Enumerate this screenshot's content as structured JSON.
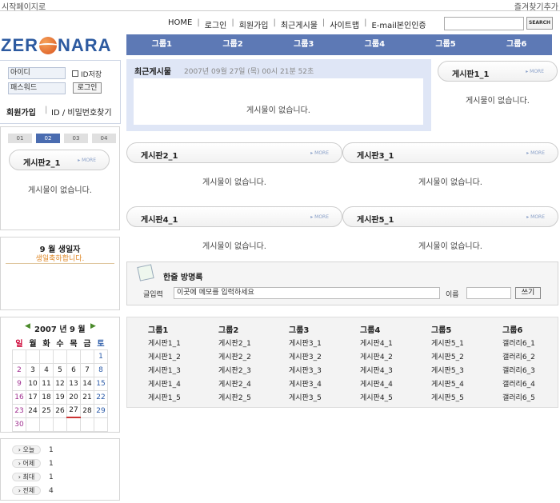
{
  "topbar": {
    "left": "시작페이지로",
    "right": "즐겨찾기추가"
  },
  "topnav": [
    "HOME",
    "로그인",
    "회원가입",
    "최근게시물",
    "사이트맵",
    "E-mail본인인증"
  ],
  "search": {
    "button": "SEARCH"
  },
  "logo": {
    "left": "ZER",
    "right": "NARA"
  },
  "nav": [
    "그룹1",
    "그룹2",
    "그룹3",
    "그룹4",
    "그룹5",
    "그룹6"
  ],
  "login": {
    "id": "아이디",
    "password": "패스워드",
    "save_id": "ID저장",
    "button": "로그인",
    "join": "회원가입",
    "find": "ID / 비밀번호찾기"
  },
  "recent": {
    "title": "최근게시물",
    "datetime": "2007년 09월 27일 (목) 00시 21분 52초",
    "empty": "게시물이 없습니다."
  },
  "more": "MORE",
  "empty_text": "게시물이 없습니다.",
  "boards": {
    "b1": "게시판1_1",
    "b2": "게시판2_1",
    "b3": "게시판3_1",
    "b4": "게시판4_1",
    "b5": "게시판5_1"
  },
  "side_tabs": [
    "01",
    "02",
    "03",
    "04"
  ],
  "birthday": {
    "title": "9 월 생일자",
    "msg": "생일축하합니다."
  },
  "calendar": {
    "title": "2007 년 9 월",
    "weekdays": [
      "일",
      "월",
      "화",
      "수",
      "목",
      "금",
      "토"
    ],
    "weeks": [
      [
        "",
        "",
        "",
        "",
        "",
        "",
        "1"
      ],
      [
        "2",
        "3",
        "4",
        "5",
        "6",
        "7",
        "8"
      ],
      [
        "9",
        "10",
        "11",
        "12",
        "13",
        "14",
        "15"
      ],
      [
        "16",
        "17",
        "18",
        "19",
        "20",
        "21",
        "22"
      ],
      [
        "23",
        "24",
        "25",
        "26",
        "27",
        "28",
        "29"
      ],
      [
        "30",
        "",
        "",
        "",
        "",
        "",
        ""
      ]
    ]
  },
  "guestbook": {
    "title": "한줄 방명록",
    "input_label": "글입력",
    "placeholder": "이곳에 메모를 입력하세요",
    "name_label": "이름",
    "write": "쓰기"
  },
  "stats": [
    {
      "label": "오늘",
      "value": "1"
    },
    {
      "label": "어제",
      "value": "1"
    },
    {
      "label": "최대",
      "value": "1"
    },
    {
      "label": "전체",
      "value": "4"
    }
  ],
  "groups": [
    {
      "title": "그룹1",
      "items": [
        "게시판1_1",
        "게시판1_2",
        "게시판1_3",
        "게시판1_4",
        "게시판1_5"
      ]
    },
    {
      "title": "그룹2",
      "items": [
        "게시판2_1",
        "게시판2_2",
        "게시판2_3",
        "게시판2_4",
        "게시판2_5"
      ]
    },
    {
      "title": "그룹3",
      "items": [
        "게시판3_1",
        "게시판3_2",
        "게시판3_3",
        "게시판3_4",
        "게시판3_5"
      ]
    },
    {
      "title": "그룹4",
      "items": [
        "게시판4_1",
        "게시판4_2",
        "게시판4_3",
        "게시판4_4",
        "게시판4_5"
      ]
    },
    {
      "title": "그룹5",
      "items": [
        "게시판5_1",
        "게시판5_2",
        "게시판5_3",
        "게시판5_4",
        "게시판5_5"
      ]
    },
    {
      "title": "그룹6",
      "items": [
        "갤러리6_1",
        "갤러리6_2",
        "갤러리6_3",
        "갤러리6_4",
        "갤러리6_5"
      ]
    }
  ]
}
